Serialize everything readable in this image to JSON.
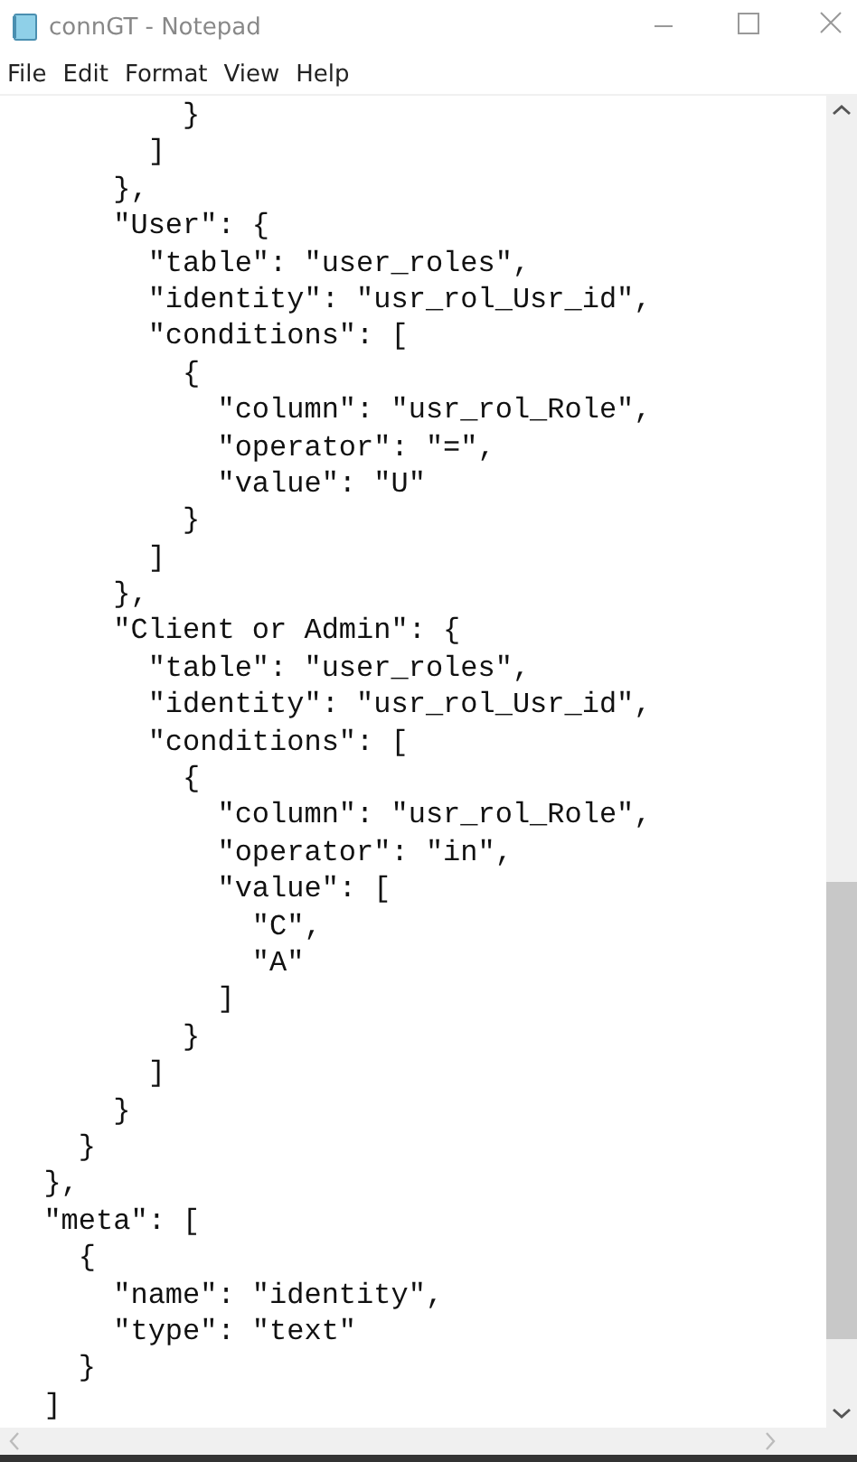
{
  "window": {
    "title": "connGT - Notepad"
  },
  "menu": [
    "File",
    "Edit",
    "Format",
    "View",
    "Help"
  ],
  "lines": [
    "          }",
    "        ]",
    "      },",
    "      \"User\": {",
    "        \"table\": \"user_roles\",",
    "        \"identity\": \"usr_rol_Usr_id\",",
    "        \"conditions\": [",
    "          {",
    "            \"column\": \"usr_rol_Role\",",
    "            \"operator\": \"=\",",
    "            \"value\": \"U\"",
    "          }",
    "        ]",
    "      },",
    "      \"Client or Admin\": {",
    "        \"table\": \"user_roles\",",
    "        \"identity\": \"usr_rol_Usr_id\",",
    "        \"conditions\": [",
    "          {",
    "            \"column\": \"usr_rol_Role\",",
    "            \"operator\": \"in\",",
    "            \"value\": [",
    "              \"C\",",
    "              \"A\"",
    "            ]",
    "          }",
    "        ]",
    "      }",
    "    }",
    "  },",
    "  \"meta\": [",
    "    {",
    "      \"name\": \"identity\",",
    "      \"type\": \"text\"",
    "    }",
    "  ]"
  ]
}
